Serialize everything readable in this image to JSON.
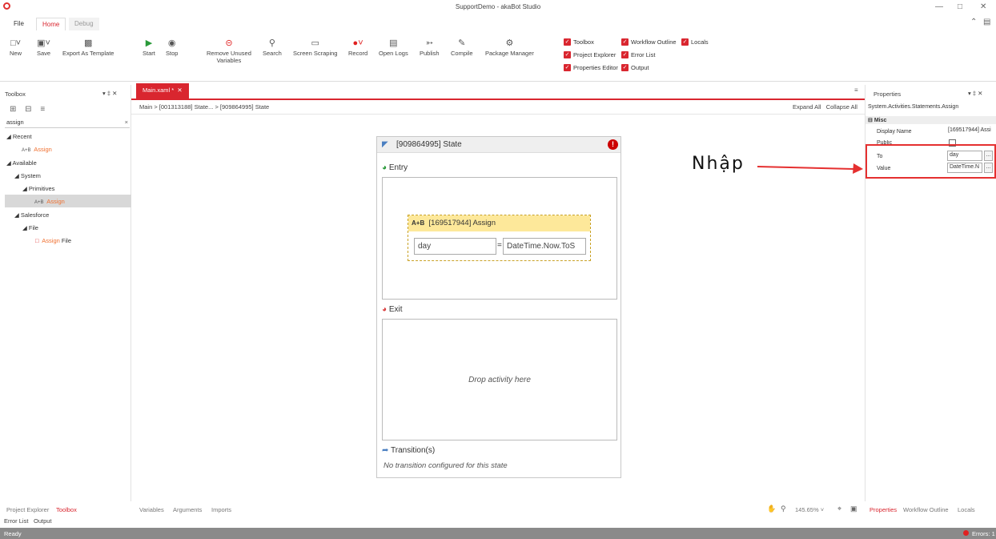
{
  "window": {
    "title": "SupportDemo - akaBot Studio"
  },
  "menu_tabs": [
    "File",
    "Home",
    "Debug"
  ],
  "ribbon": {
    "new": "New",
    "save": "Save",
    "export_template": "Export As Template",
    "start": "Start",
    "stop": "Stop",
    "remove_unused_1": "Remove Unused",
    "remove_unused_2": "Variables",
    "search": "Search",
    "screen_scraping": "Screen Scraping",
    "record": "Record",
    "open_logs": "Open Logs",
    "publish": "Publish",
    "compile": "Compile",
    "package_manager": "Package Manager",
    "checks": {
      "toolbox": "Toolbox",
      "project_explorer": "Project Explorer",
      "properties_editor": "Properties Editor",
      "workflow_outline": "Workflow Outline",
      "error_list": "Error List",
      "output": "Output",
      "locals": "Locals"
    }
  },
  "toolbox": {
    "title": "Toolbox",
    "search_value": "assign",
    "recent": "Recent",
    "recent_item": "Assign",
    "available": "Available",
    "system": "System",
    "primitives": "Primitives",
    "primitives_item": "Assign",
    "salesforce": "Salesforce",
    "file": "File",
    "file_item_1": "Assign",
    "file_item_2": "File"
  },
  "designer": {
    "tab": "Main.xaml *",
    "breadcrumb": "Main  >  [001313188] State...  >  [909864995] State",
    "expand_all": "Expand All",
    "collapse_all": "Collapse All",
    "state_title": "[909864995] State",
    "entry": "Entry",
    "assign_title": "[169517944] Assign",
    "assign_to": "day",
    "assign_eq": "=",
    "assign_value": "DateTime.Now.ToS",
    "exit": "Exit",
    "drop_text": "Drop activity here",
    "transitions": "Transition(s)",
    "no_transition": "No transition configured for this state"
  },
  "properties": {
    "title": "Properties",
    "type": "System.Activities.Statements.Assign",
    "misc": "Misc",
    "display_name_label": "Display Name",
    "display_name_value": "[169517944] Assi",
    "public_label": "Public",
    "to_label": "To",
    "to_value": "day",
    "value_label": "Value",
    "value_value": "DateTime.N",
    "ellipsis": "..."
  },
  "annotation": {
    "text": "Nhập"
  },
  "bottom": {
    "left_tabs": [
      "Project Explorer",
      "Toolbox"
    ],
    "left_tabs2": [
      "Error List",
      "Output"
    ],
    "designer_tabs": [
      "Variables",
      "Arguments",
      "Imports"
    ],
    "zoom": "145.65%",
    "right_tabs": [
      "Properties",
      "Workflow Outline",
      "Locals"
    ]
  },
  "status": {
    "ready": "Ready",
    "errors": "Errors: 1"
  }
}
